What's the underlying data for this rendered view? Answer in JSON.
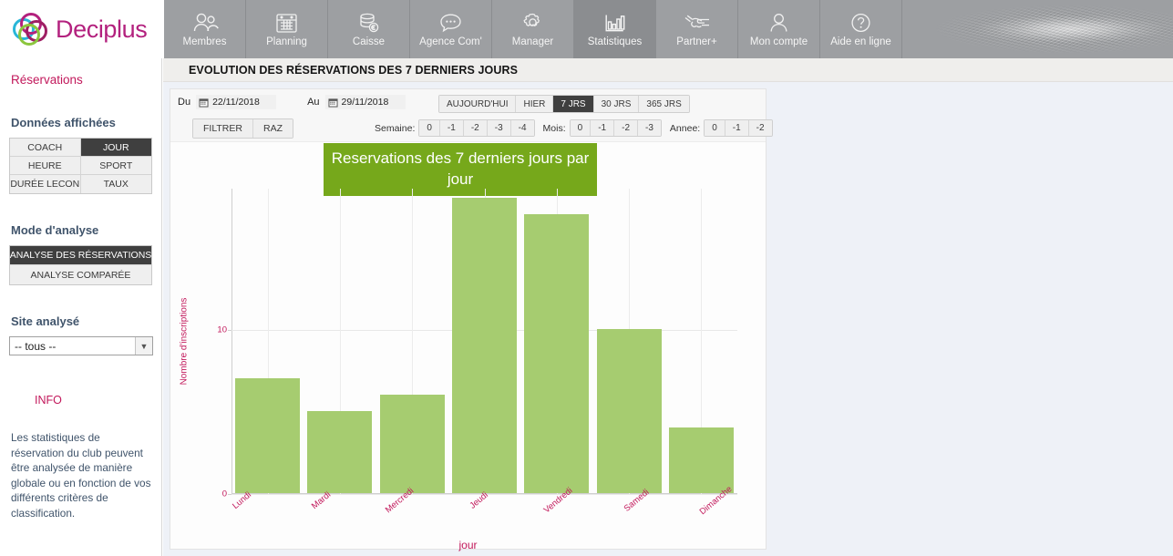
{
  "brand": {
    "name": "Deciplus",
    "logo_icon": "deciplus-circles-logo"
  },
  "nav": {
    "items": [
      {
        "label": "Membres",
        "icon": "users-icon",
        "active": false
      },
      {
        "label": "Planning",
        "icon": "calendar-icon",
        "active": false
      },
      {
        "label": "Caisse",
        "icon": "cash-euro-icon",
        "active": false
      },
      {
        "label": "Agence Com'",
        "icon": "chat-bubble-icon",
        "active": false
      },
      {
        "label": "Manager",
        "icon": "gear-icon",
        "active": false
      },
      {
        "label": "Statistiques",
        "icon": "bar-chart-icon",
        "active": true
      },
      {
        "label": "Partner+",
        "icon": "handshake-icon",
        "active": false
      },
      {
        "label": "Mon compte",
        "icon": "user-icon",
        "active": false
      },
      {
        "label": "Aide en ligne",
        "icon": "help-circle-icon",
        "active": false
      }
    ]
  },
  "sidebar": {
    "section_title": "Réservations",
    "data_heading": "Données affichées",
    "data_buttons": [
      {
        "label": "COACH",
        "active": false
      },
      {
        "label": "JOUR",
        "active": true
      },
      {
        "label": "HEURE",
        "active": false
      },
      {
        "label": "SPORT",
        "active": false
      },
      {
        "label": "DURÉE LECON",
        "active": false
      },
      {
        "label": "TAUX",
        "active": false
      }
    ],
    "mode_heading": "Mode d'analyse",
    "mode_buttons": [
      {
        "label": "ANALYSE DES RÉSERVATIONS",
        "active": true
      },
      {
        "label": "ANALYSE COMPARÉE",
        "active": false
      }
    ],
    "site_heading": "Site analysé",
    "site_select_value": "-- tous --",
    "info_title": "INFO",
    "info_text": "Les statistiques de réservation du club peuvent être analysée de manière globale ou en fonction de vos différents critères de classification."
  },
  "panel": {
    "title": "EVOLUTION DES RÉSERVATIONS DES 7 DERNIERS JOURS"
  },
  "filters": {
    "from_label": "Du",
    "from_value": "22/11/2018",
    "to_label": "Au",
    "to_value": "29/11/2018",
    "filter_button": "FILTRER",
    "reset_button": "RAZ",
    "quick_ranges": [
      {
        "label": "AUJOURD'HUI",
        "active": false
      },
      {
        "label": "HIER",
        "active": false
      },
      {
        "label": "7 JRS",
        "active": true
      },
      {
        "label": "30 JRS",
        "active": false
      },
      {
        "label": "365 JRS",
        "active": false
      }
    ],
    "week_label": "Semaine:",
    "week_steps": [
      "0",
      "-1",
      "-2",
      "-3",
      "-4"
    ],
    "month_label": "Mois:",
    "month_steps": [
      "0",
      "-1",
      "-2",
      "-3"
    ],
    "year_label": "Annee:",
    "year_steps": [
      "0",
      "-1",
      "-2"
    ]
  },
  "colors": {
    "bar_green": "#a6cc70",
    "title_green": "#76a81b",
    "accent_pink": "#c2185b",
    "nav_gray": "#9d9fa2",
    "active_dark": "#3f3f3f"
  },
  "chart_data": {
    "type": "bar",
    "title": "Reservations des 7 derniers jours par jour",
    "categories": [
      "Lundi",
      "Mardi",
      "Mercredi",
      "Jeudi",
      "Vendredi",
      "Samedi",
      "Dimanche"
    ],
    "values": [
      7,
      5,
      6,
      18,
      17,
      10,
      4
    ],
    "xlabel": "jour",
    "ylabel": "Nombre d'inscriptions",
    "ylim": [
      0,
      18.6
    ],
    "yticks": [
      0,
      10
    ],
    "grid": true,
    "legend": false
  }
}
